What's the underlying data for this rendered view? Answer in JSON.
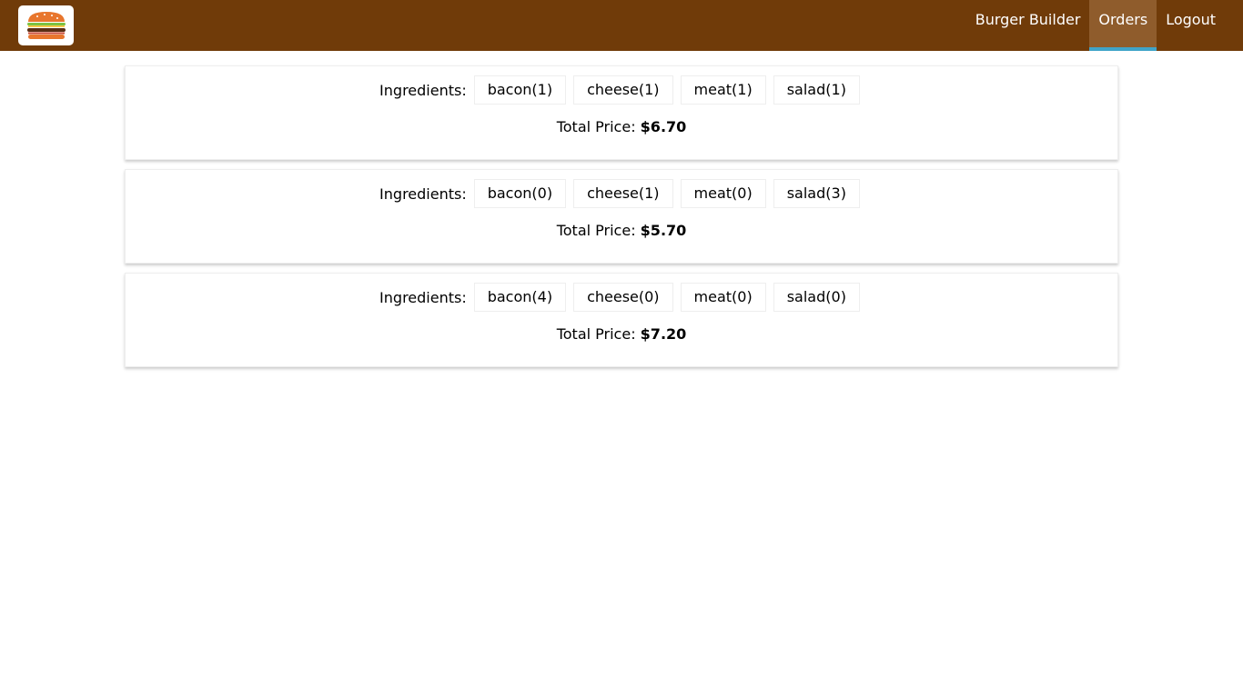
{
  "nav": {
    "logo_alt": "burger-logo",
    "items": [
      {
        "label": "Burger Builder"
      },
      {
        "label": "Orders"
      },
      {
        "label": "Logout"
      }
    ],
    "active_index": 1
  },
  "orders": [
    {
      "ingredients_label": "Ingredients:",
      "ingredients": [
        "bacon(1)",
        "cheese(1)",
        "meat(1)",
        "salad(1)"
      ],
      "price_label": "Total Price:",
      "price": "$6.70"
    },
    {
      "ingredients_label": "Ingredients:",
      "ingredients": [
        "bacon(0)",
        "cheese(1)",
        "meat(0)",
        "salad(3)"
      ],
      "price_label": "Total Price:",
      "price": "$5.70"
    },
    {
      "ingredients_label": "Ingredients:",
      "ingredients": [
        "bacon(4)",
        "cheese(0)",
        "meat(0)",
        "salad(0)"
      ],
      "price_label": "Total Price:",
      "price": "$7.20"
    }
  ],
  "colors": {
    "toolbar": "#703B09",
    "active_bg": "#8F5C2C",
    "active_border": "#40A4C8"
  }
}
